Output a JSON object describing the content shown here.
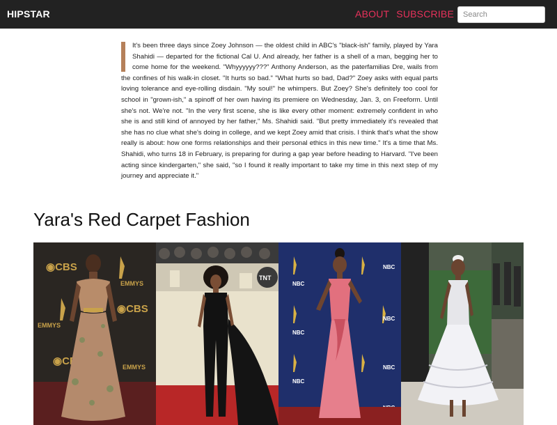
{
  "navbar": {
    "brand": "HIPSTAR",
    "links": [
      "ABOUT",
      "SUBSCRIBE"
    ],
    "search_placeholder": "Search",
    "accent_color": "#e8315b",
    "background": "#222222"
  },
  "article": {
    "body": "It's been three days since Zoey Johnson — the oldest child in ABC's \"black-ish\" family, played by Yara Shahidi — departed for the fictional Cal U. And already, her father is a shell of a man, begging her to come home for the weekend. \"Whyyyyyy???\" Anthony Anderson, as the paterfamilias Dre, wails from the confines of his walk-in closet. \"It hurts so bad.\" \"What hurts so bad, Dad?\" Zoey asks with equal parts loving tolerance and eye-rolling disdain. \"My soul!\" he whimpers. But Zoey? She's definitely too cool for school in \"grown-ish,\" a spinoff of her own having its premiere on Wednesday, Jan. 3, on Freeform. Until she's not. We're not. \"In the very first scene, she is like every other moment: extremely confident in who she is and still kind of annoyed by her father,\" Ms. Shahidi said. \"But pretty immediately it's revealed that she has no clue what she's doing in college, and we kept Zoey amid that crisis. I think that's what the show really is about: how one forms relationships and their personal ethics in this new time.\" It's a time that Ms. Shahidi, who turns 18 in February, is preparing for during a gap year before heading to Harvard. \"I've been acting since kindergarten,\" she said, \"so I found it really important to take my time in this next step of my journey and appreciate it.\""
  },
  "gallery": {
    "title": "Yara's Red Carpet Fashion",
    "photos": [
      {
        "subject": "Emmys beaded tulle gown",
        "backdrop": "CBS Emmys step-and-repeat"
      },
      {
        "subject": "black strapless jumpsuit with train",
        "backdrop": "TNT step-and-repeat"
      },
      {
        "subject": "pink halter gown",
        "backdrop": "NBC Emmys step-and-repeat"
      },
      {
        "subject": "white tiered ruffle dress",
        "backdrop": "Met Gala greenery"
      }
    ]
  }
}
